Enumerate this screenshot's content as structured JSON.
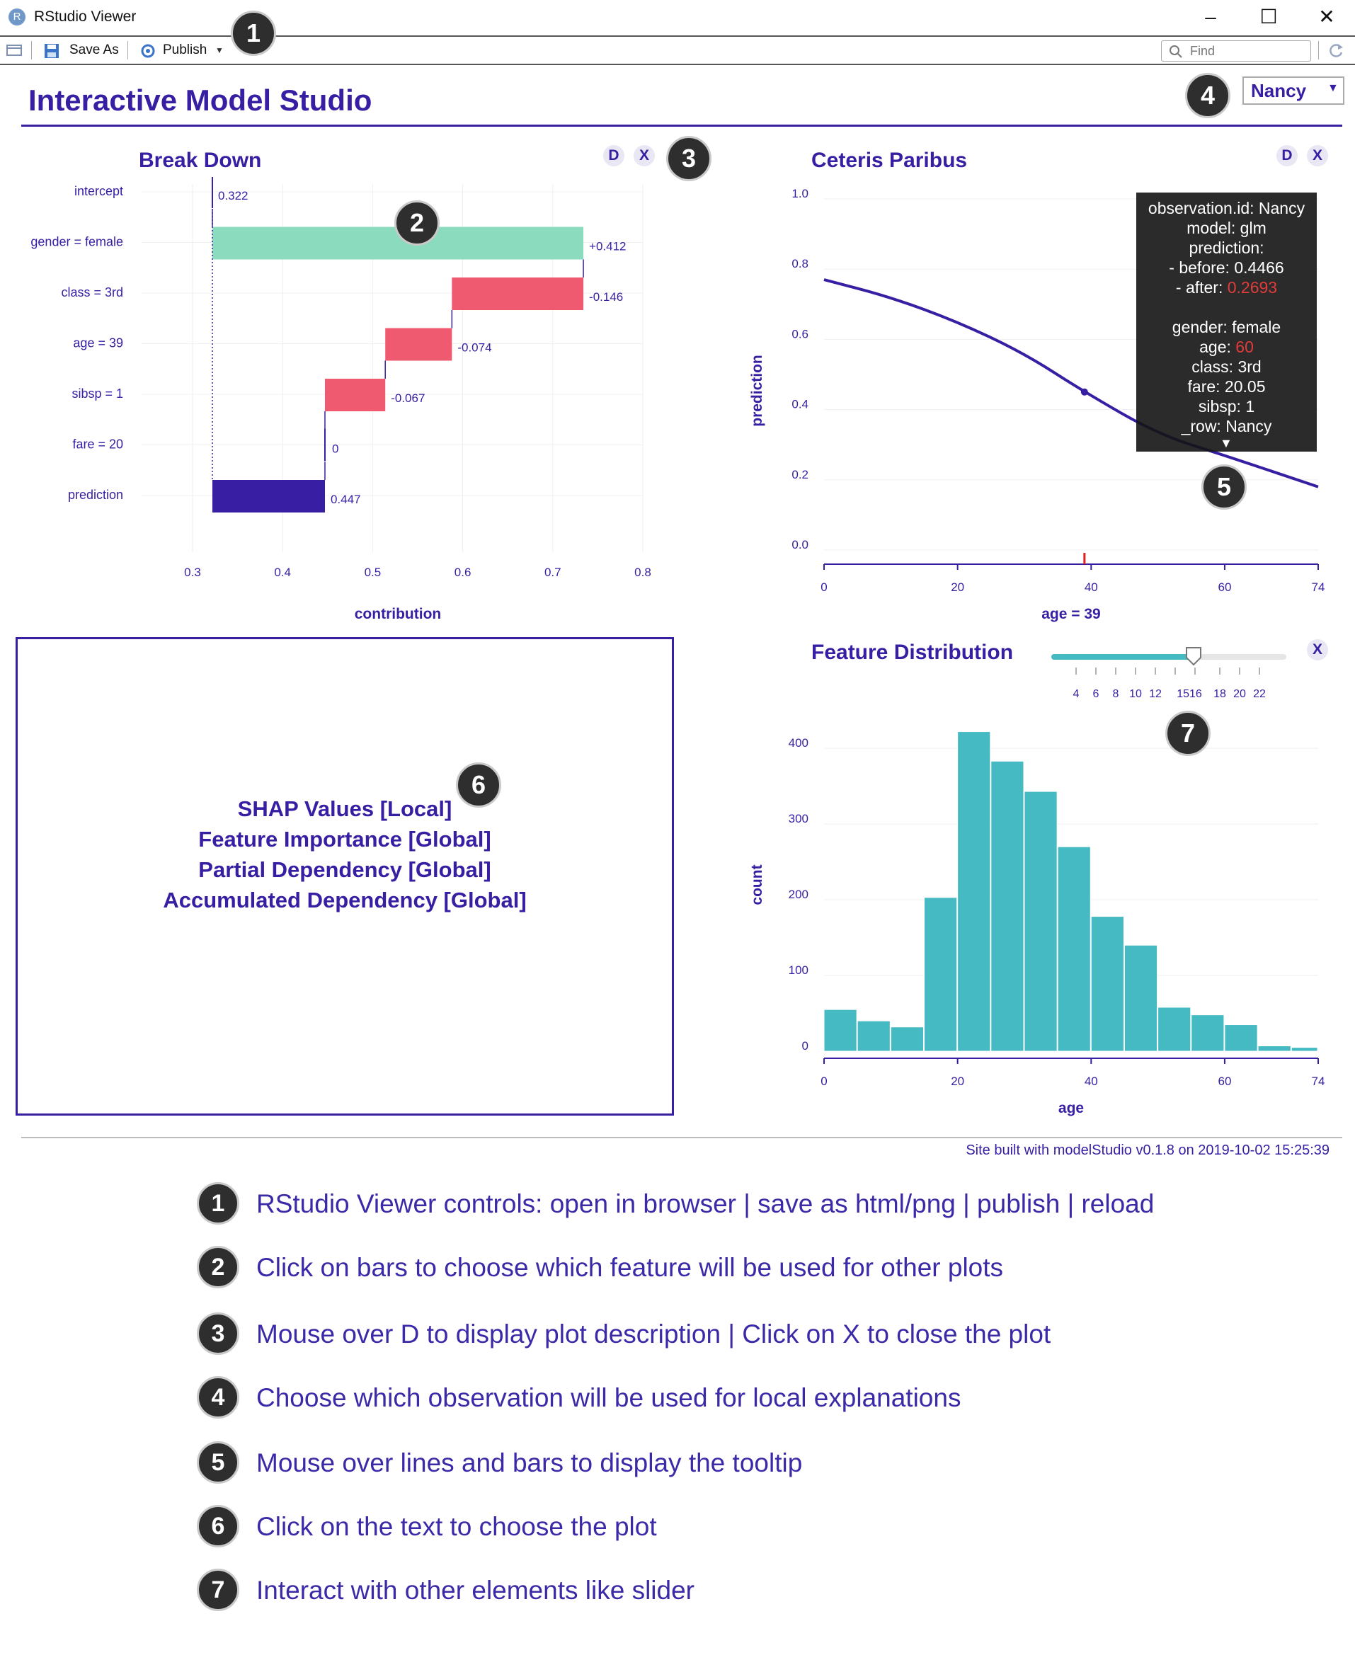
{
  "window": {
    "title": "RStudio Viewer",
    "app_icon": "R",
    "controls": [
      "minimize-icon",
      "maximize-icon",
      "close-icon"
    ]
  },
  "toolbar": {
    "open_browser_icon": "browser-icon",
    "save_label": "Save As",
    "publish_label": "Publish",
    "find_placeholder": "Find",
    "reload_icon": "reload-icon"
  },
  "header": {
    "title": "Interactive Model Studio",
    "observation": "Nancy"
  },
  "break_down": {
    "title": "Break Down",
    "buttons": [
      "D",
      "X"
    ],
    "xlabel": "contribution"
  },
  "ceteris_paribus": {
    "title": "Ceteris Paribus",
    "buttons": [
      "D",
      "X"
    ],
    "xlabel": "age = 39",
    "ylabel": "prediction",
    "tooltip": {
      "line1": "observation.id: Nancy",
      "line2": "model: glm",
      "line3": "prediction:",
      "line4": "- before: 0.4466",
      "line5_prefix": "- after: ",
      "line5_value": "0.2693",
      "line6": "gender: female",
      "line7_prefix": "age: ",
      "line7_value": "60",
      "line8": "class: 3rd",
      "line9": "fare: 20.05",
      "line10": "sibsp: 1",
      "line11": "_row: Nancy"
    }
  },
  "feature_distribution": {
    "title": "Feature Distribution",
    "close": "X",
    "slider_ticks": [
      "4",
      "6",
      "8",
      "10",
      "12",
      "1516",
      "18",
      "20",
      "22"
    ],
    "xlabel": "age",
    "ylabel": "count"
  },
  "chooser": {
    "options": [
      "SHAP Values [Local]",
      "Feature Importance [Global]",
      "Partial Dependency [Global]",
      "Accumulated Dependency [Global]"
    ]
  },
  "footer": "Site built with modelStudio v0.1.8 on 2019-10-02 15:25:39",
  "legend": [
    {
      "n": "1",
      "text": "RStudio Viewer controls: open in browser | save as html/png | publish | reload"
    },
    {
      "n": "2",
      "text": "Click on bars to choose which feature will be used for other plots"
    },
    {
      "n": "3",
      "text": "Mouse over D to display plot description | Click on X to close the plot"
    },
    {
      "n": "4",
      "text": "Choose which observation will be used for local explanations"
    },
    {
      "n": "5",
      "text": "Mouse over lines and bars to display the tooltip"
    },
    {
      "n": "6",
      "text": "Click on the text to choose the plot"
    },
    {
      "n": "7",
      "text": "Interact with other elements like slider"
    }
  ],
  "callouts": [
    "1",
    "2",
    "3",
    "4",
    "5",
    "6",
    "7"
  ],
  "colors": {
    "accent": "#371ea3",
    "positive": "#8bdcbe",
    "negative": "#f05a71",
    "prediction": "#371ea3",
    "histogram": "#46bac2"
  },
  "chart_data": [
    {
      "type": "bar",
      "subtype": "waterfall",
      "categories": [
        "intercept",
        "gender = female",
        "class = 3rd",
        "age = 39",
        "sibsp = 1",
        "fare = 20",
        "prediction"
      ],
      "values": [
        0.322,
        0.412,
        -0.146,
        -0.074,
        -0.067,
        0,
        0.447
      ],
      "labels": [
        "0.322",
        "+0.412",
        "-0.146",
        "-0.074",
        "-0.067",
        "0",
        "0.447"
      ],
      "xticks": [
        "0.3",
        "0.4",
        "0.5",
        "0.6",
        "0.7",
        "0.8"
      ],
      "xlim": [
        0.3,
        0.8
      ],
      "title": "Break Down",
      "xlabel": "contribution"
    },
    {
      "type": "line",
      "x": [
        0,
        10,
        20,
        30,
        39,
        50,
        60,
        74
      ],
      "y": [
        0.77,
        0.72,
        0.65,
        0.56,
        0.45,
        0.33,
        0.2693,
        0.18
      ],
      "observed_point": {
        "x": 39,
        "y": 0.45
      },
      "xticks": [
        "0",
        "20",
        "40",
        "60",
        "74"
      ],
      "yticks": [
        "0.0",
        "0.2",
        "0.4",
        "0.6",
        "0.8",
        "1.0"
      ],
      "xlim": [
        0,
        74
      ],
      "ylim": [
        0,
        1
      ],
      "title": "Ceteris Paribus",
      "xlabel": "age = 39",
      "ylabel": "prediction"
    },
    {
      "type": "bar",
      "subtype": "histogram",
      "bins_start": 0,
      "bin_width": 5,
      "counts": [
        55,
        40,
        32,
        203,
        422,
        383,
        343,
        270,
        178,
        140,
        58,
        48,
        35,
        7,
        5
      ],
      "xticks": [
        "0",
        "20",
        "40",
        "60",
        "74"
      ],
      "yticks": [
        "0",
        "100",
        "200",
        "300",
        "400"
      ],
      "xlim": [
        0,
        74
      ],
      "ylim": [
        0,
        430
      ],
      "title": "Feature Distribution",
      "xlabel": "age",
      "ylabel": "count"
    }
  ]
}
